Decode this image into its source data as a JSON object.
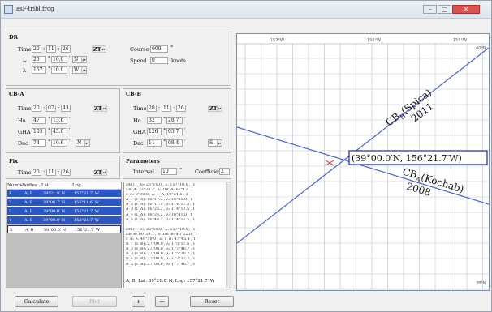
{
  "window": {
    "title": "asF-tribl.frog",
    "min": "–",
    "max": "□",
    "close": "✕"
  },
  "dr": {
    "title": "DR",
    "time_label": "Time",
    "time_h": "20",
    "time_m": "11",
    "time_s": "26",
    "zt": "ZT",
    "L_label": "L",
    "L_deg": "25",
    "L_min": "10.0",
    "L_hemi": "N",
    "lambda_label": "λ",
    "lambda_deg": "157",
    "lambda_min": "10.0",
    "lambda_hemi": "W",
    "course_label": "Course",
    "course_val": "000",
    "course_unit": "°",
    "speed_label": "Speed",
    "speed_val": "0",
    "speed_unit": "knots"
  },
  "cba": {
    "title": "CB-A",
    "time_label": "Time",
    "time_h": "20",
    "time_m": "07",
    "time_s": "43",
    "zt": "ZT",
    "ho_label": "Ho",
    "ho_deg": "47",
    "ho_min": "13.6",
    "gha_label": "GHA",
    "gha_deg": "103",
    "gha_min": "43.0",
    "dec_label": "Dec",
    "dec_deg": "74",
    "dec_min": "10.6",
    "dec_hemi": "N"
  },
  "cbb": {
    "title": "CB-B",
    "time_label": "Time",
    "time_h": "20",
    "time_m": "11",
    "time_s": "26",
    "zt": "ZT",
    "ho_label": "Ho",
    "ho_deg": "32",
    "ho_min": "28.7",
    "gha_label": "GHA",
    "gha_deg": "126",
    "gha_min": "05.7",
    "dec_label": "Dec",
    "dec_deg": "11",
    "dec_min": "08.4",
    "dec_hemi": "S"
  },
  "fix": {
    "title": "Fix",
    "time_label": "Time",
    "time_h": "20",
    "time_m": "11",
    "time_s": "26",
    "zt": "ZT"
  },
  "params": {
    "title": "Parameters",
    "interval_label": "Interval",
    "interval_val": "10",
    "coeff_label": "Coefficient",
    "coeff_val": "2"
  },
  "table": {
    "headers": [
      "Number",
      "Bodies",
      "Lat",
      "Lng"
    ],
    "rows": [
      {
        "n": "1",
        "b": "A, B",
        "lat": "39°21.0′ N",
        "lng": "157°21.7′ W"
      },
      {
        "n": "2",
        "b": "A, B",
        "lat": "39°06.7′ N",
        "lng": "156°11.6′ W"
      },
      {
        "n": "3",
        "b": "A, B",
        "lat": "39°00.0′ N",
        "lng": "156°21.7′ W"
      },
      {
        "n": "4",
        "b": "A, B",
        "lat": "39°00.0′ N",
        "lng": "156°21.7′ W"
      },
      {
        "n": "5",
        "b": "A, B",
        "lat": "39°00.0′ N",
        "lng": "156°21.7′ W"
      }
    ]
  },
  "log": {
    "lines": [
      "DR (T_A): 25°10.0′, λ: 157°10.0′, -1",
      "LB_A: 33°24.2′, λ: DR_A: 67°12′ ...",
      "c_A: 0°00.0′, λ: 1_A: 16°34.5′, 1",
      "A_1 (T_A): 16°17.2′, λ: 16°41.0′, 1",
      "A_2 (T_A): 16°17.0′, λ: 114°17.5′, 1",
      "A_3 (T_A): 16°24.2′, λ: 114°17.5′, 1",
      "A_4 (T_A): 16°24.2′, λ: 16°41.0′, 1",
      "A_5 (T_A): 16°44.2′, λ: 114°17.5′, 1",
      "",
      "DR (T_B): 25°10.0′, λ: 157°10.0′, -1",
      "LB_B: 60°39.7′, λ: DR_B: 40°22.0′, 1",
      "c_B: λ: 40°59.0′, λ: 1_B: 47°45.4′, 1",
      "B_1 (T_B): 27°00.0′, λ: 175°57.6′, 1",
      "B_2 (T_B): 27°00.0′, λ: 177°46.7′, 1",
      "B_3 (T_B): 27°00.0′, λ: 175°20.7′, 1",
      "B_4 (T_B): 27°00.0′, λ: 172°37.7′, 1",
      "B_5 (T_B): 27°00.0′, λ: 177°46.7′, 1"
    ],
    "footer": "A, B: Lat: 39°21.0′ N, Lng: 157°21.7′ W"
  },
  "buttons": {
    "calculate": "Calculate",
    "plot": "Plot",
    "plus": "+",
    "minus": "—",
    "reset": "Reset"
  },
  "plot": {
    "top_labels": [
      "157°W",
      "156°W",
      "155°W"
    ],
    "top_right": "40°N",
    "bottom_right": "38°N",
    "cbb_label": "CB",
    "cbb_sub": "B",
    "cbb_star": "(Spica)",
    "cbb_year": "2011",
    "cba_label": "CB",
    "cba_sub": "A",
    "cba_star": "(Kochab)",
    "cba_year": "2008",
    "fix_label": "(39°00.0′N, 156°21.7′W)",
    "line_a_color": "#4a62d8",
    "line_b_color": "#4a62d8",
    "fix_color": "#d0302a",
    "box_color": "#1a2aa0"
  }
}
